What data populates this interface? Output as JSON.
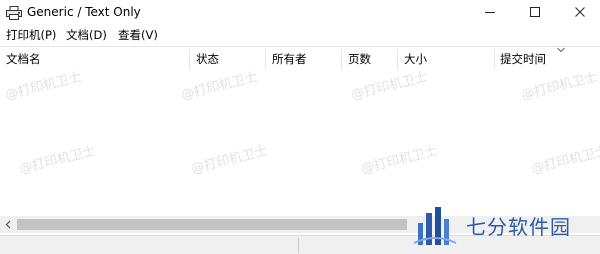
{
  "window": {
    "title": "Generic / Text Only",
    "icon": "printer-icon",
    "controls": [
      "minimize-icon",
      "maximize-icon",
      "close-icon"
    ]
  },
  "menu": {
    "printer": "打印机(P)",
    "document": "文档(D)",
    "view": "查看(V)"
  },
  "columns": {
    "doc_name": "文档名",
    "status": "状态",
    "owner": "所有者",
    "pages": "页数",
    "size": "大小",
    "submitted": "提交时间"
  },
  "watermark_text": "@打印机卫士",
  "brand": {
    "name": "七分软件园",
    "color": "#2a5aa8"
  }
}
